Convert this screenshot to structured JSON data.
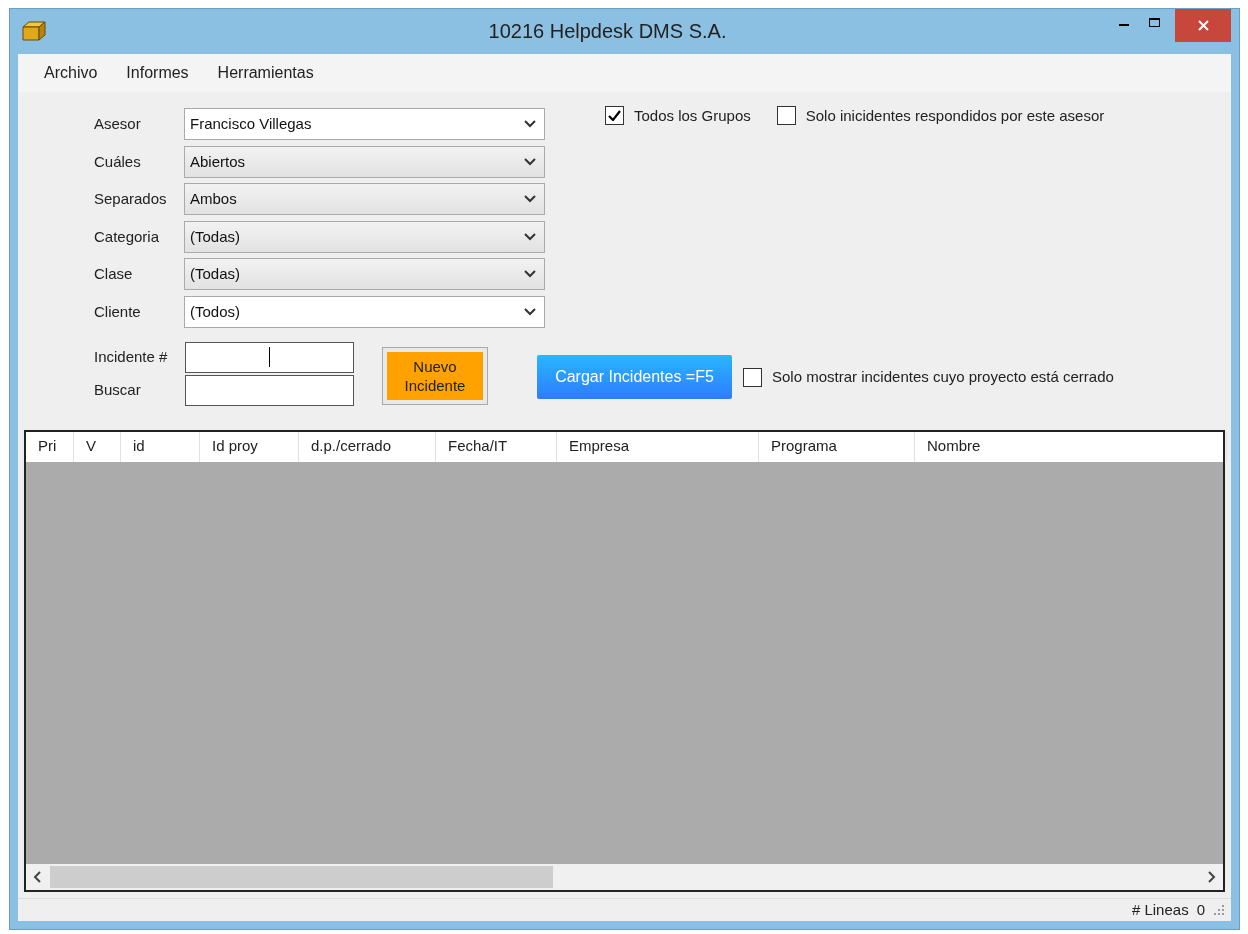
{
  "window": {
    "title": "10216 Helpdesk DMS S.A."
  },
  "menu": [
    "Archivo",
    "Informes",
    "Herramientas"
  ],
  "filters": [
    {
      "label": "Asesor",
      "value": "Francisco Villegas",
      "editable": true
    },
    {
      "label": "Cuáles",
      "value": "Abiertos",
      "editable": false
    },
    {
      "label": "Separados",
      "value": "Ambos",
      "editable": false
    },
    {
      "label": "Categoria",
      "value": "(Todas)",
      "editable": false
    },
    {
      "label": "Clase",
      "value": "(Todas)",
      "editable": false
    },
    {
      "label": "Cliente",
      "value": "(Todos)",
      "editable": true
    }
  ],
  "options": [
    {
      "label": "Todos los Grupos",
      "checked": true
    },
    {
      "label": "Solo inicidentes respondidos por este asesor",
      "checked": false
    }
  ],
  "incident_field": {
    "label": "Incidente #",
    "focused": true
  },
  "search_field": {
    "label": "Buscar"
  },
  "new_button": "Nuevo Incidente",
  "load_button": "Cargar Incidentes =F5",
  "closed_option": {
    "label": "Solo mostrar incidentes cuyo proyecto está cerrado",
    "checked": false
  },
  "table": {
    "columns": [
      "Pri",
      "V",
      "id",
      "Id proy",
      "d.p./cerrado",
      "Fecha/IT",
      "Empresa",
      "Programa",
      "Nombre"
    ]
  },
  "status_bar": {
    "label": "# Lineas",
    "count": "0"
  }
}
